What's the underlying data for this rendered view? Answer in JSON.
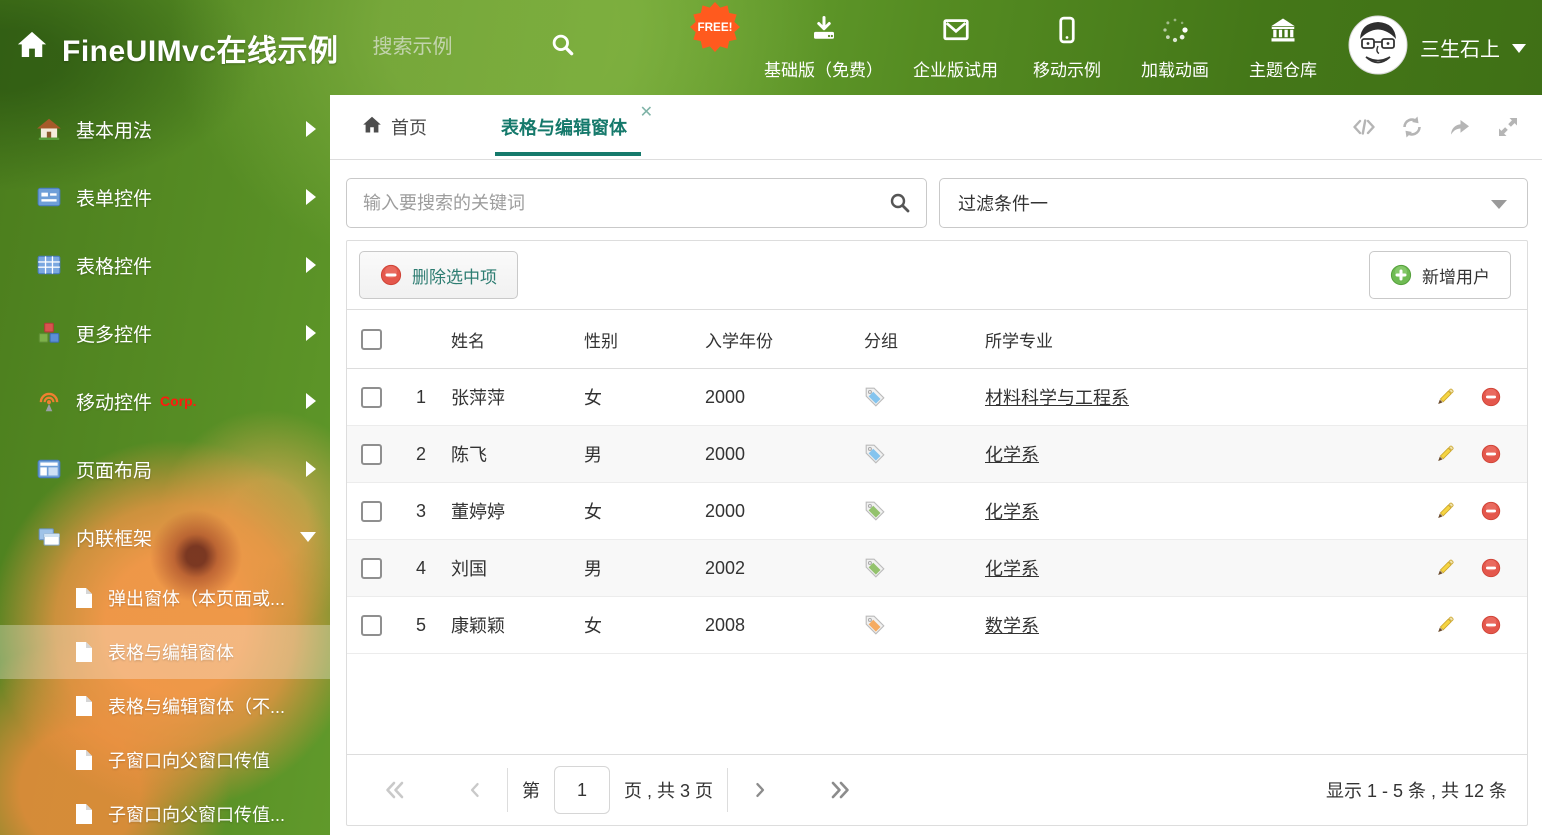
{
  "header": {
    "title": "FineUIMvc在线示例",
    "search_placeholder": "搜索示例",
    "free_badge": "FREE!",
    "nav": [
      {
        "label": "基础版（免费）",
        "icon": "download-icon"
      },
      {
        "label": "企业版试用",
        "icon": "envelope-icon"
      },
      {
        "label": "移动示例",
        "icon": "mobile-icon"
      },
      {
        "label": "加载动画",
        "icon": "spinner-icon"
      },
      {
        "label": "主题仓库",
        "icon": "bank-icon"
      }
    ],
    "user": {
      "name": "三生石上"
    }
  },
  "sidebar": {
    "items": [
      {
        "label": "基本用法",
        "icon": "home-icon"
      },
      {
        "label": "表单控件",
        "icon": "form-icon"
      },
      {
        "label": "表格控件",
        "icon": "table-icon"
      },
      {
        "label": "更多控件",
        "icon": "cubes-icon"
      },
      {
        "label": "移动控件",
        "badge": "Corp.",
        "icon": "antenna-icon"
      },
      {
        "label": "页面布局",
        "icon": "layout-icon"
      },
      {
        "label": "内联框架",
        "icon": "frames-icon",
        "expanded": true
      }
    ],
    "subitems": [
      {
        "label": "弹出窗体（本页面或..."
      },
      {
        "label": "表格与编辑窗体",
        "selected": true
      },
      {
        "label": "表格与编辑窗体（不..."
      },
      {
        "label": "子窗口向父窗口传值"
      },
      {
        "label": "子窗口向父窗口传值..."
      }
    ]
  },
  "tabs": {
    "home_label": "首页",
    "active_label": "表格与编辑窗体",
    "close_glyph": "✕"
  },
  "search": {
    "placeholder": "输入要搜索的关键词"
  },
  "filter": {
    "value": "过滤条件一"
  },
  "toolbar": {
    "delete_label": "删除选中项",
    "add_label": "新增用户"
  },
  "table": {
    "headers": [
      "姓名",
      "性别",
      "入学年份",
      "分组",
      "所学专业"
    ],
    "rows": [
      {
        "num": "1",
        "name": "张萍萍",
        "gender": "女",
        "year": "2000",
        "tag": "blue",
        "major": "材料科学与工程系"
      },
      {
        "num": "2",
        "name": "陈飞",
        "gender": "男",
        "year": "2000",
        "tag": "blue",
        "major": "化学系"
      },
      {
        "num": "3",
        "name": "董婷婷",
        "gender": "女",
        "year": "2000",
        "tag": "green",
        "major": "化学系"
      },
      {
        "num": "4",
        "name": "刘国",
        "gender": "男",
        "year": "2002",
        "tag": "green",
        "major": "化学系"
      },
      {
        "num": "5",
        "name": "康颖颖",
        "gender": "女",
        "year": "2008",
        "tag": "orange",
        "major": "数学系"
      }
    ]
  },
  "pagination": {
    "page_prefix": "第",
    "page": "1",
    "page_suffix": "页 , 共 3 页",
    "summary": "显示 1 - 5 条 , 共 12 条"
  },
  "colors": {
    "accent_teal": "#15796b",
    "header_green": "#558c22",
    "free_badge_orange": "#ff5a1e",
    "corp_red": "#ff1a0e",
    "tag_blue": "#85c4ee",
    "tag_green": "#93c26d",
    "tag_orange": "#f5ab62",
    "delete_red": "#e4574c",
    "add_green": "#6fbb53",
    "pencil_yellow": "#f5d442"
  }
}
